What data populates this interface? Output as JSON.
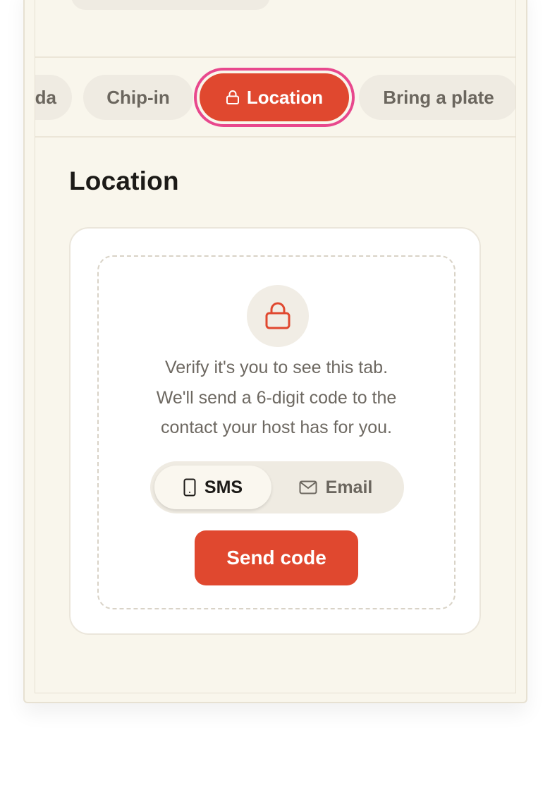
{
  "tabs": {
    "agenda_label": "Agenda",
    "chipin_label": "Chip-in",
    "location_label": "Location",
    "bring_label": "Bring a plate",
    "active": "Location"
  },
  "section": {
    "title": "Location"
  },
  "verify": {
    "lines": [
      "Verify it's you to see this tab.",
      "We'll send a 6-digit code to the",
      "contact your host has for you."
    ],
    "methods": {
      "sms_label": "SMS",
      "email_label": "Email",
      "selected": "SMS"
    },
    "send_label": "Send code"
  },
  "colors": {
    "accent": "#e0482f",
    "focus_ring": "#e8488d",
    "background": "#f9f6ec",
    "pill": "#efebe2"
  },
  "icons": {
    "locked_tab": "lock-icon",
    "verify": "lock-icon",
    "sms": "phone-icon",
    "email": "mail-icon"
  }
}
